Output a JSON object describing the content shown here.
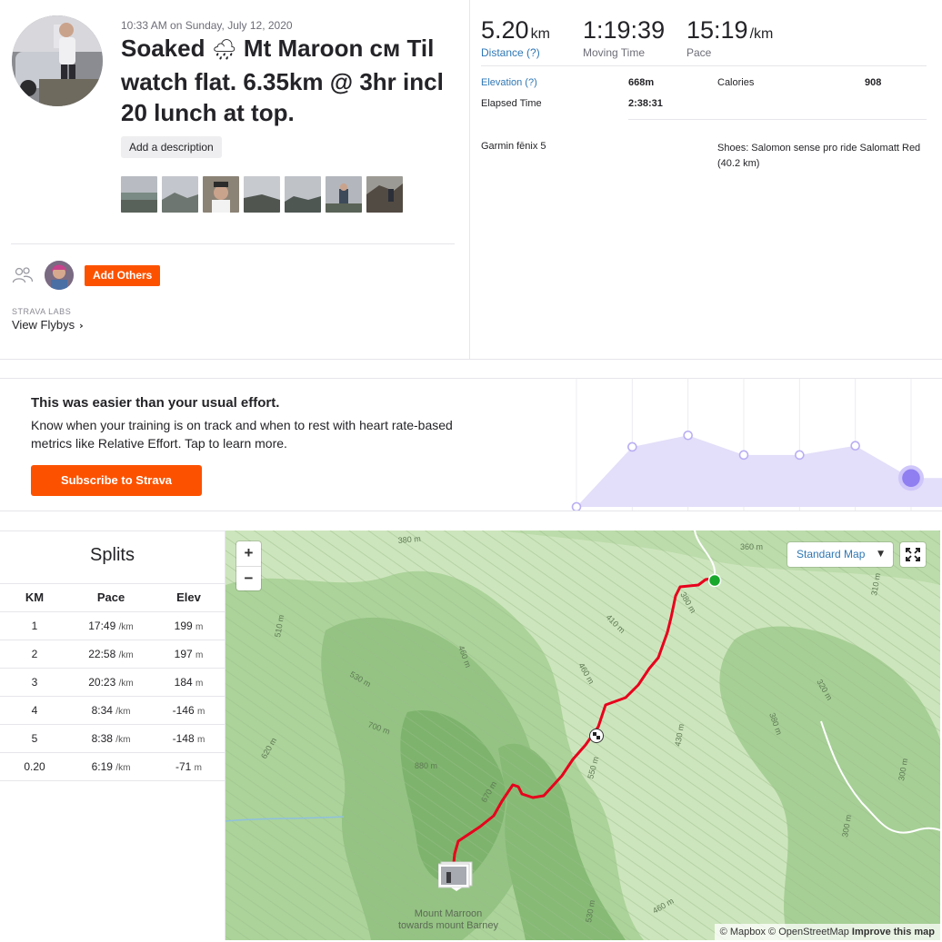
{
  "activity": {
    "timestamp": "10:33 AM on Sunday, July 12, 2020",
    "title_part1": "Soaked",
    "title_emoji": "🌧",
    "title_part2": "Mt Maroon ᴄᴍ Til watch flat. 6.35km @ 3hr incl 20 lunch at top.",
    "add_description": "Add a description",
    "photo_count": 7
  },
  "social": {
    "add_others": "Add Others",
    "labs_label": "STRAVA LABS",
    "view_flybys": "View Flybys",
    "chevron": "›"
  },
  "stats": {
    "distance": {
      "value": "5.20",
      "unit": "km",
      "label": "Distance (?)"
    },
    "moving_time": {
      "value": "1:19:39",
      "label": "Moving Time"
    },
    "pace": {
      "value": "15:19",
      "unit": "/km",
      "label": "Pace"
    },
    "elevation_label": "Elevation (?)",
    "elevation_value": "668m",
    "calories_label": "Calories",
    "calories_value": "908",
    "elapsed_label": "Elapsed Time",
    "elapsed_value": "2:38:31",
    "device": "Garmin fēnix 5",
    "shoes": "Shoes: Salomon sense pro ride Salomatt Red (40.2 km)"
  },
  "effort": {
    "title": "This was easier than your usual effort.",
    "body": "Know when your training is on track and when to rest with heart rate-based metrics like Relative Effort. Tap to learn more.",
    "cta": "Subscribe to Strava",
    "chart_data": {
      "type": "area",
      "values": [
        0,
        0.52,
        0.62,
        0.45,
        0.45,
        0.53,
        0.25
      ],
      "highlight_last": true,
      "colors": {
        "fill": "#e3def9",
        "line": "#b9aef3",
        "point": "#8f7ff0"
      }
    }
  },
  "splits": {
    "title": "Splits",
    "headers": [
      "KM",
      "Pace",
      "Elev"
    ],
    "pace_unit": "/km",
    "elev_unit": "m",
    "rows": [
      {
        "km": "1",
        "pace": "17:49",
        "elev": "199"
      },
      {
        "km": "2",
        "pace": "22:58",
        "elev": "197"
      },
      {
        "km": "3",
        "pace": "20:23",
        "elev": "184"
      },
      {
        "km": "4",
        "pace": "8:34",
        "elev": "-146"
      },
      {
        "km": "5",
        "pace": "8:38",
        "elev": "-148"
      },
      {
        "km": "0.20",
        "pace": "6:19",
        "elev": "-71"
      }
    ]
  },
  "map": {
    "zoom_in": "+",
    "zoom_out": "−",
    "style_label": "Standard Map",
    "caret": "▼",
    "attribution_1": "© Mapbox",
    "attribution_2": "© OpenStreetMap",
    "attribution_link": "Improve this map",
    "poi_line1": "Mount Marroon",
    "poi_line2": "towards mount Barney",
    "contour_labels": [
      "380 m",
      "360 m",
      "380 m",
      "410 m",
      "460 m",
      "510 m",
      "530 m",
      "460 m",
      "700 m",
      "620 m",
      "880 m",
      "670 m",
      "550 m",
      "430 m",
      "380 m",
      "320 m",
      "310 m",
      "300 m",
      "300 m",
      "460 m",
      "530 m"
    ],
    "colors": {
      "route": "#e8001c",
      "start": "#18a82b",
      "water": "#8fc0de",
      "road": "#ffffff"
    }
  },
  "colors": {
    "brand": "#fc5200",
    "link": "#2f77b4",
    "text": "#242428"
  }
}
